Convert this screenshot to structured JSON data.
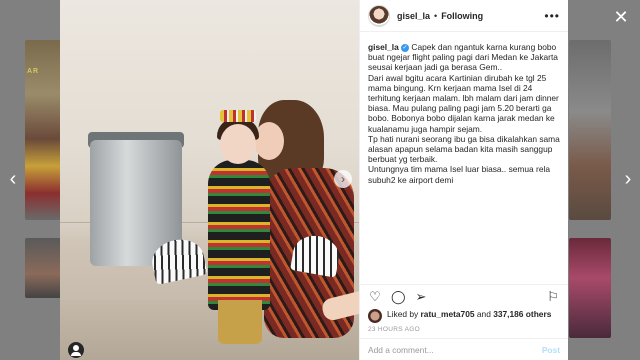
{
  "background": {
    "banner_text": "AR",
    "prev_arrow": "‹",
    "next_arrow": "›",
    "close_glyph": "✕"
  },
  "post": {
    "username": "gisel_la",
    "follow_state": "Following",
    "separator": "•",
    "more_glyph": "•••",
    "slide_next_glyph": "›",
    "caption": {
      "author": "gisel_la",
      "verified_glyph": "✓",
      "paragraphs": [
        "Capek dan ngantuk karna kurang bobo buat ngejar flight paling pagi dari Medan ke Jakarta seusai kerjaan jadi ga berasa Gem..",
        "Dari awal bgitu acara Kartinian dirubah ke tgl 25 mama bingung. Krn kerjaan mama Isel di 24 terhitung kerjaan malam. lbh malam dari jam dinner biasa. Mau pulang paling pagi jam 5.20 berarti ga bobo. Bobonya bobo dijalan karna jarak medan ke kualanamu juga hampir sejam.",
        "Tp hati nurani seorang ibu ga bisa dikalahkan sama alasan apapun selama badan kita masih sanggup berbuat yg terbaik.",
        "Untungnya tim mama Isel luar biasa.. semua rela subuh2 ke airport demi"
      ]
    },
    "actions": {
      "like_glyph": "♡",
      "comment_glyph": "◯",
      "share_glyph": "➢",
      "save_glyph": "⚐"
    },
    "likes": {
      "prefix": "Liked by",
      "user": "ratu_meta705",
      "conjunction": "and",
      "others": "337,186 others"
    },
    "time_ago": "23 HOURS AGO",
    "comment": {
      "placeholder": "Add a comment...",
      "post_label": "Post"
    }
  }
}
